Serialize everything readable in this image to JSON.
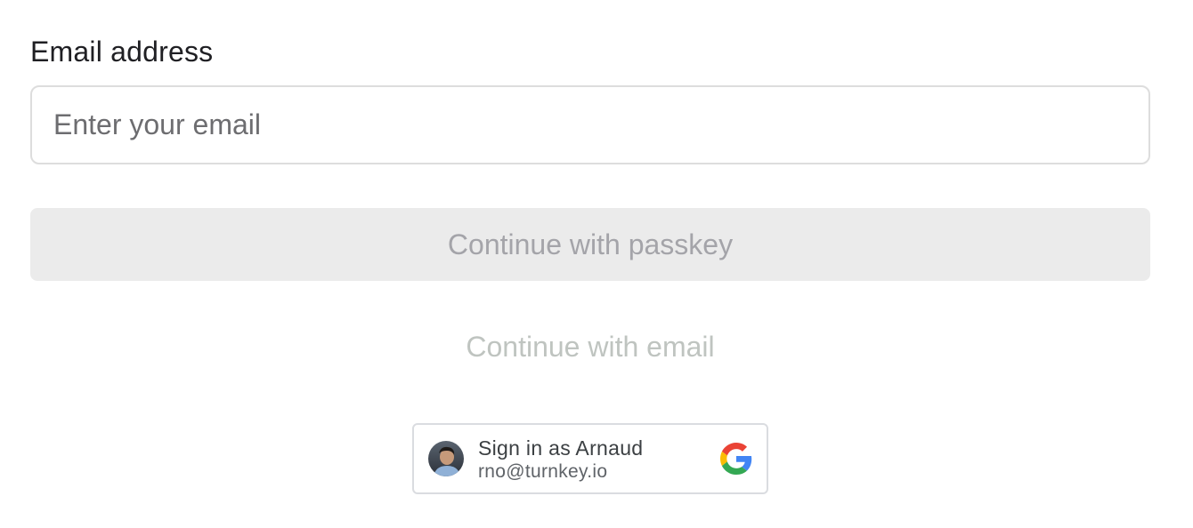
{
  "form": {
    "email_label": "Email address",
    "email_value": "",
    "email_placeholder": "Enter your email",
    "passkey_button_label": "Continue with passkey",
    "email_button_label": "Continue with email"
  },
  "google_signin": {
    "title": "Sign in as Arnaud",
    "email": "rno@turnkey.io",
    "icon": "google-g-icon",
    "avatar": "user-avatar-photo"
  },
  "colors": {
    "label_text": "#1f1f23",
    "input_border": "#dddddd",
    "passkey_bg": "#ebebeb",
    "passkey_text": "#a4a4a9",
    "email_link_text": "#bfc4c0",
    "google_border": "#dadce0",
    "google_blue": "#4285F4",
    "google_red": "#EA4335",
    "google_yellow": "#FBBC05",
    "google_green": "#34A853"
  }
}
